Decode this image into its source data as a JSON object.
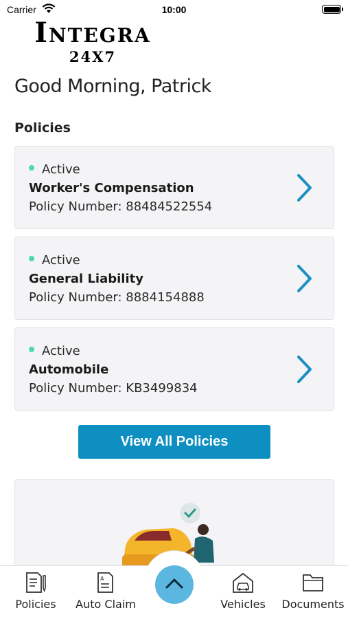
{
  "status_bar": {
    "carrier": "Carrier",
    "time": "10:00"
  },
  "logo": {
    "line1": "Integra",
    "line2": "24X7"
  },
  "greeting": "Good Morning, Patrick",
  "policies_section": {
    "title": "Policies",
    "items": [
      {
        "status": "Active",
        "name": "Worker's Compensation",
        "number": "Policy Number: 88484522554"
      },
      {
        "status": "Active",
        "name": "General Liability",
        "number": "Policy Number: 8884154888"
      },
      {
        "status": "Active",
        "name": "Automobile",
        "number": "Policy Number: KB3499834"
      }
    ],
    "view_all_label": "View All Policies"
  },
  "tab_bar": {
    "tabs": [
      {
        "label": "Policies",
        "icon": "document-pen-icon"
      },
      {
        "label": "Auto Claim",
        "icon": "claim-form-icon"
      },
      {
        "label": "",
        "icon": "chevron-up-icon"
      },
      {
        "label": "Vehicles",
        "icon": "car-garage-icon"
      },
      {
        "label": "Documents",
        "icon": "folder-icon"
      }
    ]
  },
  "colors": {
    "accent": "#0e8fc1",
    "active_dot": "#4fd6b4",
    "card_bg": "#f4f4f6",
    "center_button": "#5bb6e0"
  }
}
